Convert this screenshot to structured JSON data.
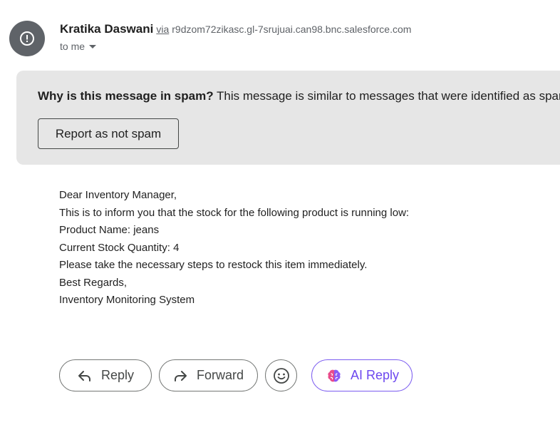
{
  "sender": {
    "name": "Kratika Daswani",
    "via_label": "via",
    "domain": "r9dzom72zikasc.gl-7srujuai.can98.bnc.salesforce.com",
    "to_label": "to me",
    "avatar_icon": "alert-circle-icon",
    "avatar_color": "#5f6368"
  },
  "spam_banner": {
    "question": "Why is this message in spam?",
    "explanation": "This message is similar to messages that were identified as spam in the past.",
    "button_label": "Report as not spam",
    "background": "#e6e6e6"
  },
  "body": {
    "lines": [
      "Dear Inventory Manager,",
      "This is to inform you that the stock for the following product is running low:",
      "Product Name: jeans",
      "Current Stock Quantity: 4",
      "Please take the necessary steps to restock this item immediately.",
      "Best Regards,",
      "Inventory Monitoring System"
    ]
  },
  "actions": {
    "reply_label": "Reply",
    "forward_label": "Forward",
    "ai_reply_label": "AI Reply",
    "emoji_icon": "smiley-icon",
    "ai_accent": "#6c47ef"
  }
}
